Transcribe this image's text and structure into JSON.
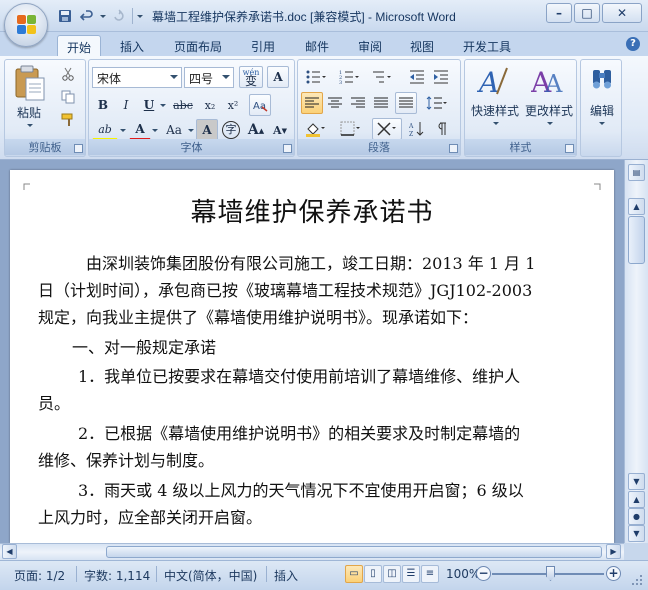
{
  "window": {
    "title": "幕墙工程维护保养承诺书.doc [兼容模式] - Microsoft Word",
    "minimize": "–",
    "maximize": "□",
    "close": "✕"
  },
  "quick_access": {
    "save_icon": "save-icon",
    "undo_icon": "undo-icon",
    "redo_icon": "redo-icon"
  },
  "tabs": [
    {
      "label": "开始",
      "active": true
    },
    {
      "label": "插入",
      "active": false
    },
    {
      "label": "页面布局",
      "active": false
    },
    {
      "label": "引用",
      "active": false
    },
    {
      "label": "邮件",
      "active": false
    },
    {
      "label": "审阅",
      "active": false
    },
    {
      "label": "视图",
      "active": false
    },
    {
      "label": "开发工具",
      "active": false
    }
  ],
  "help": "?",
  "ribbon": {
    "clipboard": {
      "paste_label": "粘贴",
      "group_label": "剪贴板"
    },
    "font": {
      "font_name": "宋体",
      "font_size": "四号",
      "phonetic_label": "wén",
      "phonetic_char": "变",
      "group_label": "字体",
      "bold": "B",
      "italic": "I",
      "underline": "U",
      "strike": "abc",
      "subscript": "x₂",
      "superscript": "x²",
      "highlight": "ab",
      "font_color": "A",
      "change_case": "Aa",
      "char_shade": "A",
      "enclose": "字",
      "grow": "A",
      "shrink": "A"
    },
    "paragraph": {
      "group_label": "段落"
    },
    "styles": {
      "quick_styles": "快速样式",
      "change_styles": "更改样式",
      "group_label": "样式"
    },
    "editing": {
      "label": "编辑"
    }
  },
  "document": {
    "title": "幕墙维护保养承诺书",
    "paragraphs": [
      "由深圳装饰集团股份有限公司施工，竣工日期：2013 年 1 月 1",
      "日（计划时间），承包商已按《玻璃幕墙工程技术规范》JGJ102-2003",
      "规定，向我业主提供了《幕墙使用维护说明书》。现承诺如下：",
      "一、对一般规定承诺",
      "1．我单位已按要求在幕墙交付使用前培训了幕墙维修、维护人",
      "员。",
      "2．已根据《幕墙使用维护说明书》的相关要求及时制定幕墙的",
      "维修、保养计划与制度。",
      "3．雨天或 4 级以上风力的天气情况下不宜使用开启窗；6 级以",
      "上风力时，应全部关闭开启窗。"
    ]
  },
  "status": {
    "page": "页面: 1/2",
    "words": "字数: 1,114",
    "language": "中文(简体，中国)",
    "mode": "插入",
    "zoom": "100%",
    "zoom_out": "−",
    "zoom_in": "+"
  }
}
